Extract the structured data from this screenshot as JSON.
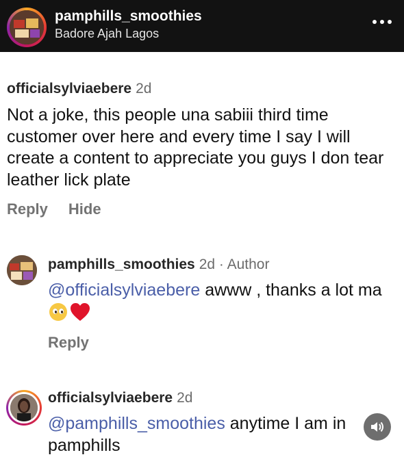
{
  "header": {
    "title": "pamphills_smoothies",
    "subtitle": "Badore Ajah Lagos",
    "more_icon": "more-horizontal-icon"
  },
  "comment": {
    "username": "officialsylviaebere",
    "time": "2d",
    "text": "Not a joke, this people una sabiii third time customer over here and every time I say I will create a content to appreciate you guys I don tear leather lick plate",
    "actions": {
      "reply": "Reply",
      "hide": "Hide"
    }
  },
  "replies": [
    {
      "username": "pamphills_smoothies",
      "meta": "2d · Author",
      "mention": "@officialsylviaebere",
      "text": " awww , thanks a lot ma",
      "emojis": [
        "pleading-face-icon",
        "red-heart-icon"
      ],
      "reply_label": "Reply"
    },
    {
      "username": "officialsylviaebere",
      "meta": "2d",
      "mention": "@pamphills_smoothies",
      "text": " anytime I am in pamphills"
    }
  ],
  "overlay": {
    "icon": "speaker-icon"
  }
}
